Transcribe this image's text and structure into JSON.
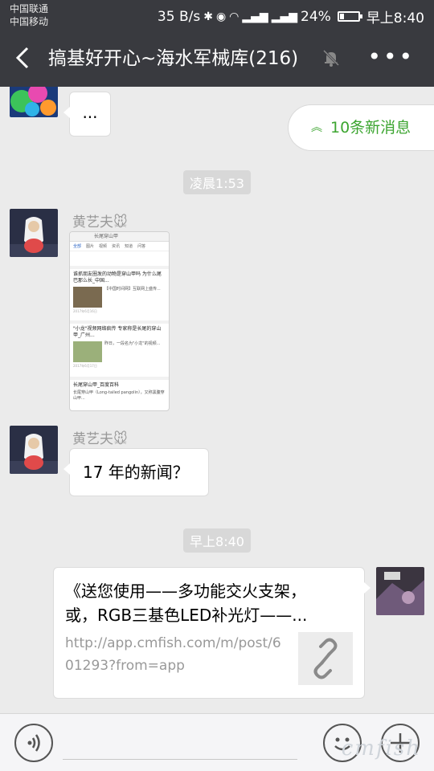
{
  "status_bar": {
    "carrier_1": "中国联通",
    "carrier_2": "中国移动",
    "speed": "35 B/s",
    "battery": "24%",
    "battery_level": 0.24,
    "time": "早上8:40"
  },
  "header": {
    "title": "搞基好开心~海水军械库(216)",
    "back_icon": "back-arrow-icon",
    "mute_icon": "mute-bell-icon",
    "more_icon": "more-dots-icon"
  },
  "banner": {
    "new_messages_label": "10条新消息"
  },
  "messages": {
    "top_bubble_text": "...",
    "time_1": "凌晨1:53",
    "sender_1": "黄艺夫🐭",
    "screenshot": {
      "tabs": [
        "全部",
        "图片",
        "视频",
        "资讯",
        "知道",
        "问答"
      ],
      "search_text": "长尾穿山甲",
      "results": [
        {
          "title": "谁抓朋友圈发的动物是穿山甲吗 为什么尾巴那么长_中国...",
          "snippet": "【中国时间网】互联网上盛传...",
          "date": "2017年6月16日"
        },
        {
          "title": "\"小龙\"视频网络疯传 专家称是长尾的穿山甲_广州...",
          "snippet": "昨日，一段名为\"小龙\"的视频...",
          "date": "2017年6月17日"
        },
        {
          "title": "长尾穿山甲_百度百科",
          "snippet": "长尾穿山甲（Long-tailed pangolin），又称黑腹穿山甲...",
          "date": ""
        }
      ]
    },
    "sender_2": "黄艺夫🐭",
    "text_message": "17 年的新闻？",
    "time_2": "早上8:40",
    "link_card": {
      "title_line_1": "《送您使用——多功能交火支架，",
      "title_line_2": "或，RGB三基色LED补光灯——...",
      "url": "http://app.cmfish.com/m/post/601293?from=app",
      "link_icon": "chain-link-icon"
    }
  },
  "bottom_bar": {
    "voice_icon": "voice-icon",
    "emoji_icon": "emoji-icon",
    "plus_icon": "plus-icon",
    "watermark": "cmfish"
  }
}
